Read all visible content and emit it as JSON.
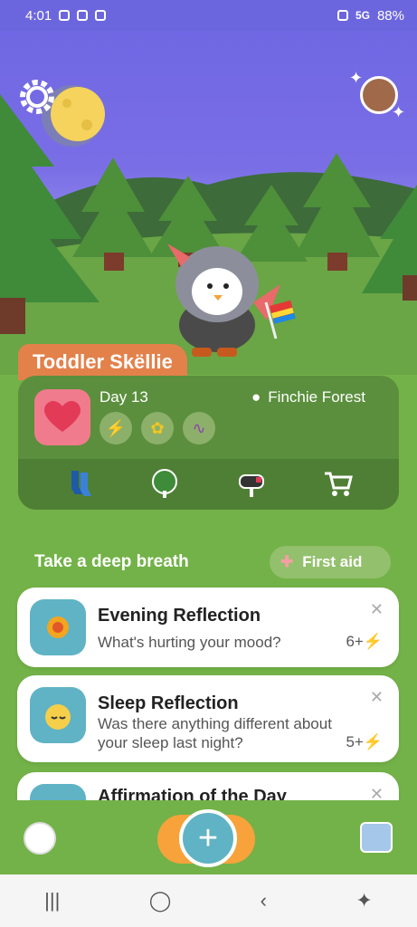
{
  "status_bar": {
    "time": "4:01",
    "network": "5G",
    "battery": "88%"
  },
  "pet": {
    "name": "Toddler Skëllie",
    "day": "Day 13",
    "location": "Finchie Forest"
  },
  "actions": [
    "socks-icon",
    "tree-icon",
    "mailbox-icon",
    "cart-icon"
  ],
  "section": {
    "title": "Take a deep breath",
    "first_aid": "First aid"
  },
  "cards": [
    {
      "title": "Evening Reflection",
      "subtitle": "What's hurting your mood?",
      "points": "6+"
    },
    {
      "title": "Sleep Reflection",
      "subtitle": "Was there anything different about your sleep last night?",
      "points": "5+"
    },
    {
      "title": "Affirmation of the Day"
    }
  ],
  "colors": {
    "sky": "#6f67e3",
    "grass": "#73b248",
    "card_accent": "#e3814a",
    "thumb": "#5fb3c5"
  }
}
